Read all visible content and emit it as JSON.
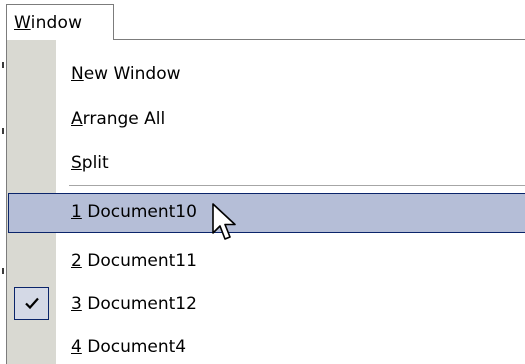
{
  "menu": {
    "title": "Window",
    "title_mnemonic": "W"
  },
  "items": [
    {
      "mnemonic": "N",
      "rest": "ew Window"
    },
    {
      "mnemonic": "A",
      "rest": "rrange All"
    },
    {
      "mnemonic": "S",
      "rest": "plit"
    },
    {
      "mnemonic": "1",
      "rest": " Document10",
      "highlighted": true
    },
    {
      "mnemonic": "2",
      "rest": " Document11"
    },
    {
      "mnemonic": "3",
      "rest": " Document12",
      "checked": true
    },
    {
      "mnemonic": "4",
      "rest": " Document4"
    }
  ],
  "colors": {
    "gutter": "#d9d9d2",
    "highlight_fill": "#b5bed7",
    "highlight_border": "#0a246a",
    "border": "#7c7c7c"
  },
  "icons": {
    "check": "checkmark-icon",
    "cursor": "mouse-pointer-icon"
  }
}
